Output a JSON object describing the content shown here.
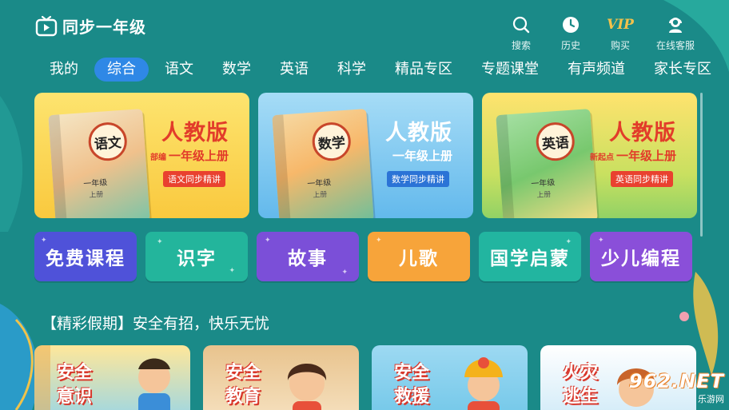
{
  "header": {
    "app_title": "同步一年级",
    "actions": [
      {
        "label": "搜索",
        "icon": "search-icon"
      },
      {
        "label": "历史",
        "icon": "clock-icon"
      },
      {
        "label": "购买",
        "icon": "vip-icon",
        "badge": "VIP"
      },
      {
        "label": "在线客服",
        "icon": "customer-service-icon"
      }
    ]
  },
  "nav": {
    "tabs": [
      {
        "label": "我的",
        "active": false
      },
      {
        "label": "综合",
        "active": true
      },
      {
        "label": "语文",
        "active": false
      },
      {
        "label": "数学",
        "active": false
      },
      {
        "label": "英语",
        "active": false
      },
      {
        "label": "科学",
        "active": false
      },
      {
        "label": "精品专区",
        "active": false
      },
      {
        "label": "专题课堂",
        "active": false
      },
      {
        "label": "有声频道",
        "active": false
      },
      {
        "label": "家长专区",
        "active": false
      }
    ]
  },
  "banners": [
    {
      "subject": "语文",
      "edition": "人教版",
      "prefix": "部编",
      "volume": "一年级上册",
      "tagline": "语文同步精讲",
      "book_grade": "一年级",
      "book_term": "上册"
    },
    {
      "subject": "数学",
      "edition": "人教版",
      "prefix": "",
      "volume": "一年级上册",
      "tagline": "数学同步精讲",
      "book_grade": "一年级",
      "book_term": "上册"
    },
    {
      "subject": "英语",
      "edition": "人教版",
      "prefix": "新起点",
      "volume": "一年级上册",
      "tagline": "英语同步精讲",
      "book_grade": "一年级",
      "book_term": "上册"
    }
  ],
  "categories": [
    {
      "label": "免费课程",
      "color": "#4f52d9"
    },
    {
      "label": "识字",
      "color": "#23b59c"
    },
    {
      "label": "故事",
      "color": "#7b4fd8"
    },
    {
      "label": "儿歌",
      "color": "#f7a43a"
    },
    {
      "label": "国学启蒙",
      "color": "#22b5a0"
    },
    {
      "label": "少儿编程",
      "color": "#8a4fd9"
    }
  ],
  "section": {
    "title": "【精彩假期】安全有招，快乐无忧"
  },
  "holiday_cards": [
    {
      "label": "安全意识"
    },
    {
      "label": "安全教育"
    },
    {
      "label": "安全救援"
    },
    {
      "label": "火灾逃生"
    }
  ],
  "watermark": {
    "number": "962.NET",
    "sub": "乐游网"
  },
  "colors": {
    "background": "#1a8a88",
    "active_tab": "#2f88e6",
    "accent_red": "#e23c2a",
    "vip_gold": "#f3c24b"
  }
}
